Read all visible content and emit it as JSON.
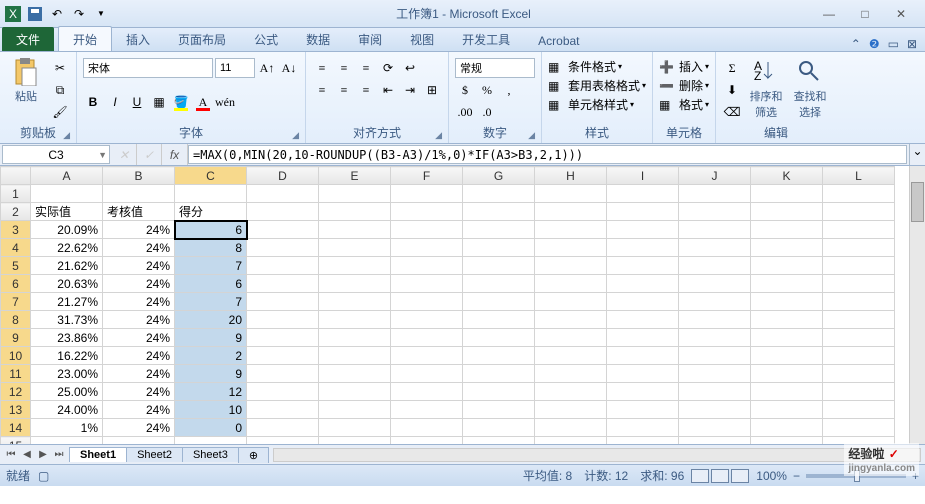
{
  "app_title": "工作簿1 - Microsoft Excel",
  "tabs": {
    "file": "文件",
    "home": "开始",
    "insert": "插入",
    "layout": "页面布局",
    "formulas": "公式",
    "data": "数据",
    "review": "审阅",
    "view": "视图",
    "dev": "开发工具",
    "acrobat": "Acrobat"
  },
  "ribbon": {
    "clipboard": {
      "paste": "粘贴",
      "label": "剪贴板"
    },
    "font": {
      "name": "宋体",
      "size": "11",
      "label": "字体"
    },
    "align": {
      "label": "对齐方式"
    },
    "number": {
      "format": "常规",
      "label": "数字"
    },
    "styles": {
      "cond": "条件格式",
      "table": "套用表格格式",
      "cell": "单元格样式",
      "label": "样式"
    },
    "cells": {
      "insert": "插入",
      "delete": "删除",
      "format": "格式",
      "label": "单元格"
    },
    "editing": {
      "sort": "排序和筛选",
      "find": "查找和选择",
      "label": "编辑"
    }
  },
  "name_box": "C3",
  "formula": "=MAX(0,MIN(20,10-ROUNDUP((B3-A3)/1%,0)*IF(A3>B3,2,1)))",
  "columns": [
    "A",
    "B",
    "C",
    "D",
    "E",
    "F",
    "G",
    "H",
    "I",
    "J",
    "K",
    "L"
  ],
  "headers": {
    "a": "实际值",
    "b": "考核值",
    "c": "得分"
  },
  "rows": [
    {
      "r": "3",
      "a": "20.09%",
      "b": "24%",
      "c": "6"
    },
    {
      "r": "4",
      "a": "22.62%",
      "b": "24%",
      "c": "8"
    },
    {
      "r": "5",
      "a": "21.62%",
      "b": "24%",
      "c": "7"
    },
    {
      "r": "6",
      "a": "20.63%",
      "b": "24%",
      "c": "6"
    },
    {
      "r": "7",
      "a": "21.27%",
      "b": "24%",
      "c": "7"
    },
    {
      "r": "8",
      "a": "31.73%",
      "b": "24%",
      "c": "20"
    },
    {
      "r": "9",
      "a": "23.86%",
      "b": "24%",
      "c": "9"
    },
    {
      "r": "10",
      "a": "16.22%",
      "b": "24%",
      "c": "2"
    },
    {
      "r": "11",
      "a": "23.00%",
      "b": "24%",
      "c": "9"
    },
    {
      "r": "12",
      "a": "25.00%",
      "b": "24%",
      "c": "12"
    },
    {
      "r": "13",
      "a": "24.00%",
      "b": "24%",
      "c": "10"
    },
    {
      "r": "14",
      "a": "1%",
      "b": "24%",
      "c": "0"
    }
  ],
  "sheets": {
    "s1": "Sheet1",
    "s2": "Sheet2",
    "s3": "Sheet3"
  },
  "status": {
    "ready": "就绪",
    "avg": "平均值: 8",
    "count": "计数: 12",
    "sum": "求和: 96",
    "zoom": "100%"
  },
  "watermark": {
    "name": "经验啦",
    "url": "jingyanla.com"
  }
}
